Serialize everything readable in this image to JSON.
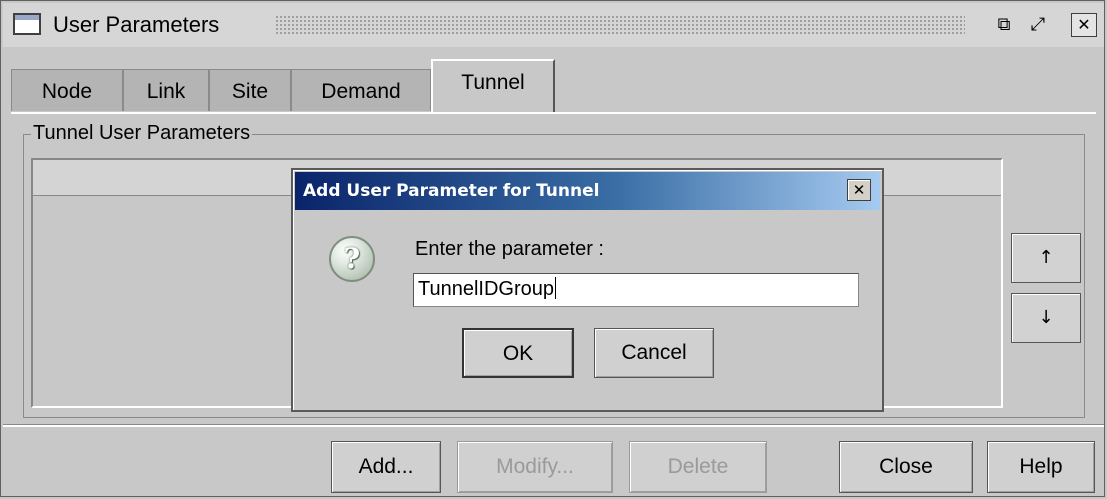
{
  "window": {
    "title": "User Parameters",
    "title_icon": "window-icon",
    "controls": {
      "minimize_glyph": "⧉",
      "maximize_glyph": "⤢",
      "close_glyph": "✕"
    }
  },
  "tabs": [
    {
      "label": "Node",
      "active": false
    },
    {
      "label": "Link",
      "active": false
    },
    {
      "label": "Site",
      "active": false
    },
    {
      "label": "Demand",
      "active": false
    },
    {
      "label": "Tunnel",
      "active": true
    }
  ],
  "group": {
    "legend": "Tunnel User Parameters"
  },
  "reorder": {
    "up_glyph": "↑",
    "down_glyph": "↓"
  },
  "buttons": {
    "add": "Add...",
    "modify": "Modify...",
    "delete": "Delete",
    "close": "Close",
    "help": "Help"
  },
  "dialog": {
    "title": "Add User Parameter for Tunnel",
    "close_glyph": "✕",
    "icon": "question-icon",
    "icon_glyph": "?",
    "prompt": "Enter the parameter :",
    "input_value": "TunnelIDGroup",
    "ok": "OK",
    "cancel": "Cancel"
  },
  "colors": {
    "dialog_title_start": "#0a246a",
    "dialog_title_end": "#a6caf0",
    "window_bg": "#c8c8c8"
  }
}
